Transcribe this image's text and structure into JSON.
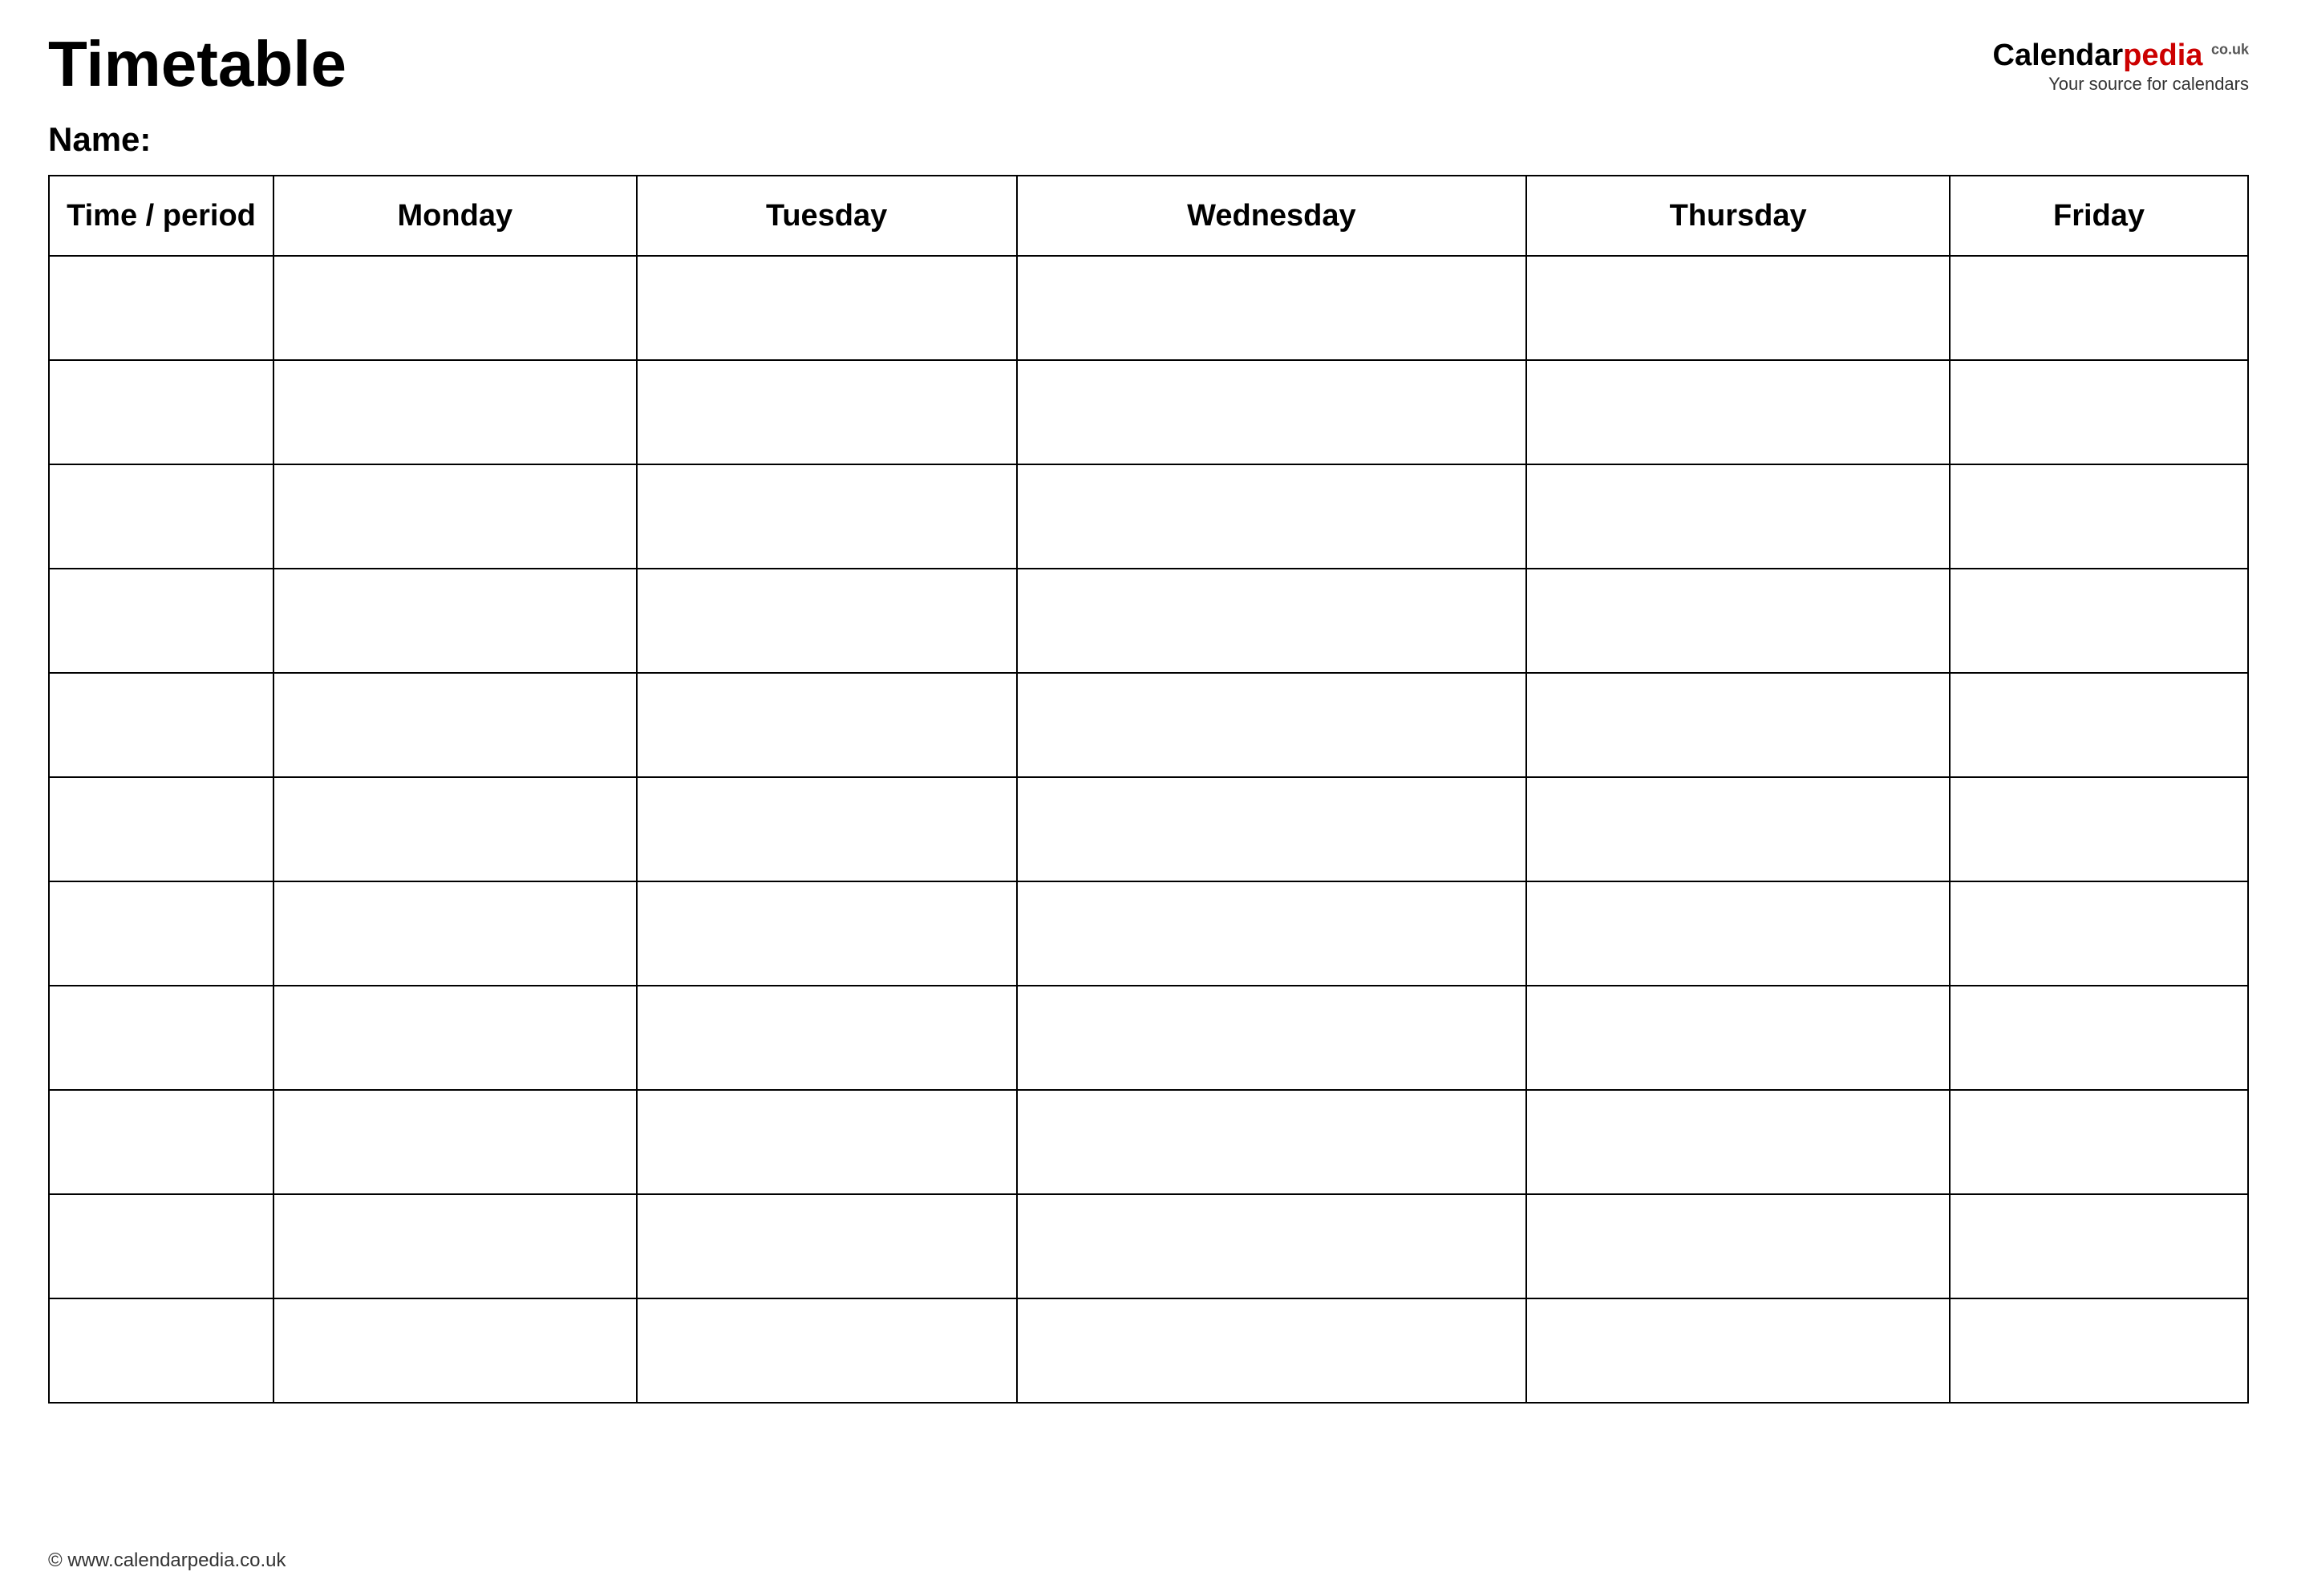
{
  "page": {
    "title": "Timetable",
    "name_label": "Name:",
    "footer_text": "© www.calendarpedia.co.uk"
  },
  "logo": {
    "calendar_text": "Calendar",
    "pedia_text": "pedia",
    "domain_top": "co.uk",
    "subtitle": "Your source for calendars"
  },
  "table": {
    "headers": [
      {
        "id": "time-period",
        "label": "Time / period"
      },
      {
        "id": "monday",
        "label": "Monday"
      },
      {
        "id": "tuesday",
        "label": "Tuesday"
      },
      {
        "id": "wednesday",
        "label": "Wednesday"
      },
      {
        "id": "thursday",
        "label": "Thursday"
      },
      {
        "id": "friday",
        "label": "Friday"
      }
    ],
    "row_count": 11
  }
}
